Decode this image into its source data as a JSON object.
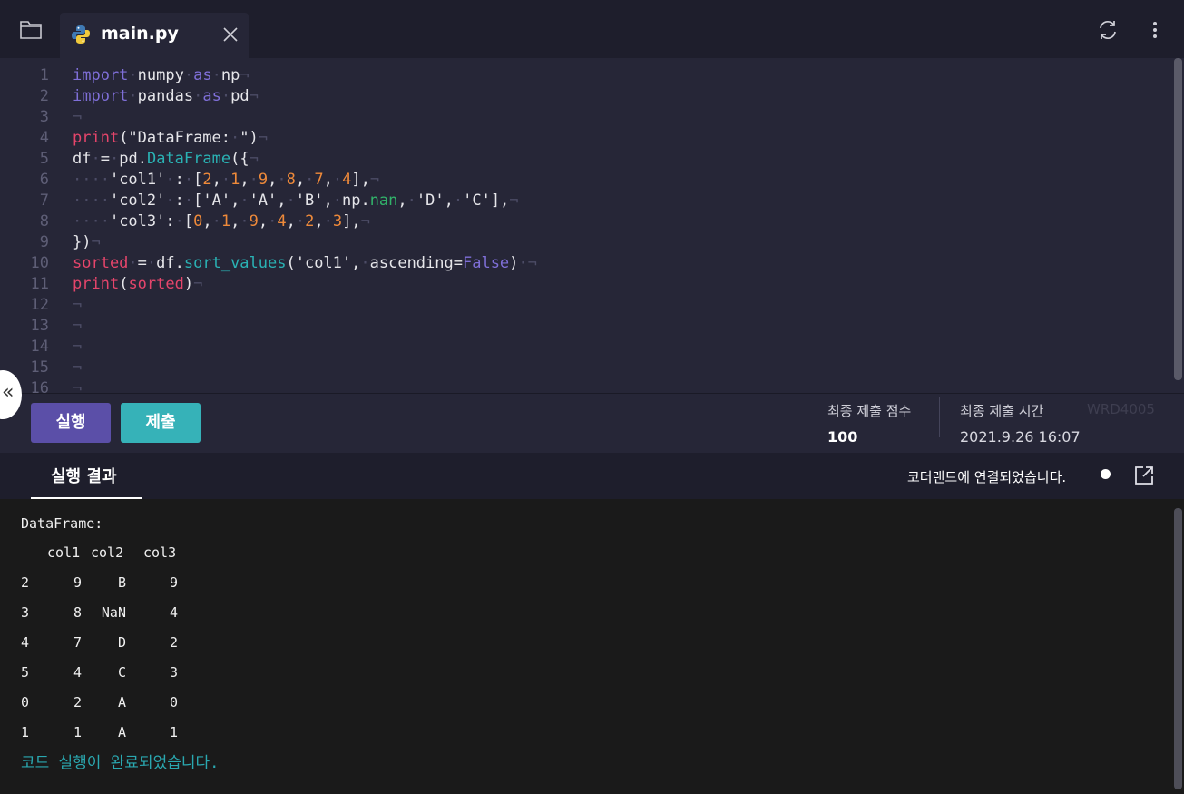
{
  "tab": {
    "filename": "main.py"
  },
  "editor": {
    "line_numbers": [
      "1",
      "2",
      "3",
      "4",
      "5",
      "6",
      "7",
      "8",
      "9",
      "10",
      "11",
      "12",
      "13",
      "14",
      "15",
      "16"
    ]
  },
  "actions": {
    "run_label": "실행",
    "submit_label": "제출"
  },
  "score": {
    "label": "최종 제출 점수",
    "value": "100"
  },
  "submit_time": {
    "label": "최종 제출 시간",
    "value": "2021.9.26 16:07"
  },
  "watermark": "WRD4005",
  "result": {
    "tab_label": "실행 결과",
    "connection_status": "코더랜드에 연결되었습니다.",
    "output_title": "DataFrame:",
    "columns": [
      "col1",
      "col2",
      "col3"
    ],
    "rows": [
      {
        "index": "2",
        "col1": "9",
        "col2": "B",
        "col3": "9"
      },
      {
        "index": "3",
        "col1": "8",
        "col2": "NaN",
        "col3": "4"
      },
      {
        "index": "4",
        "col1": "7",
        "col2": "D",
        "col3": "2"
      },
      {
        "index": "5",
        "col1": "4",
        "col2": "C",
        "col3": "3"
      },
      {
        "index": "0",
        "col1": "2",
        "col2": "A",
        "col3": "0"
      },
      {
        "index": "1",
        "col1": "1",
        "col2": "A",
        "col3": "1"
      }
    ],
    "done_message": "코드 실행이 완료되었습니다."
  },
  "colors": {
    "run": "#5b4fa8",
    "submit": "#36b2b8",
    "done": "#2aa8b0"
  },
  "icons": {
    "folder": "folder-icon",
    "python": "python-icon",
    "close": "close-icon",
    "refresh": "refresh-icon",
    "more": "more-vertical-icon",
    "collapse": "double-chevron-left-icon",
    "external": "external-link-icon"
  }
}
